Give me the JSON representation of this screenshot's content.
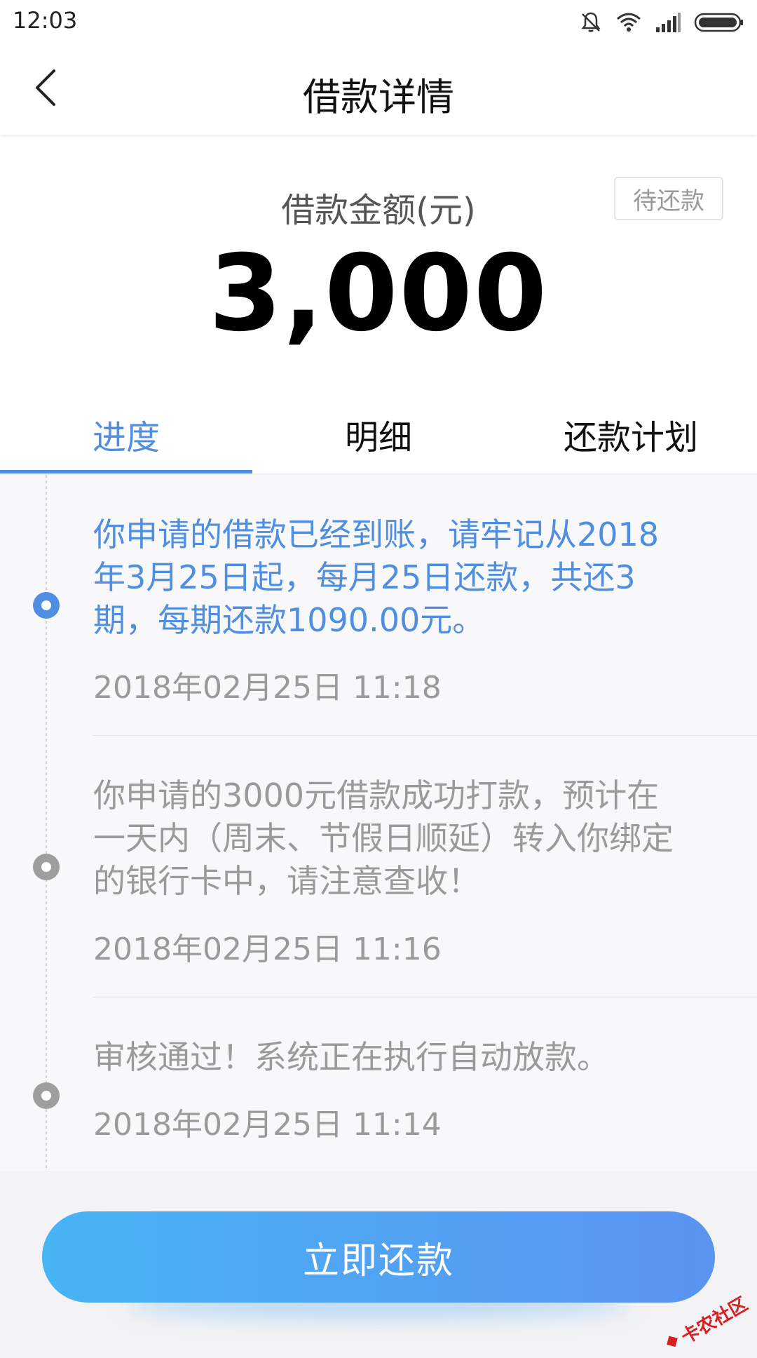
{
  "status_bar": {
    "time": "12:03"
  },
  "header": {
    "title": "借款详情"
  },
  "loan": {
    "amount_label": "借款金额(元)",
    "amount": "3,000",
    "status_badge": "待还款"
  },
  "tabs": [
    {
      "label": "进度",
      "active": true
    },
    {
      "label": "明细",
      "active": false
    },
    {
      "label": "还款计划",
      "active": false
    }
  ],
  "timeline": [
    {
      "lines": [
        "你申请的借款已经到账，请牢记从2018",
        "年3月25日起，每月25日还款，共还3",
        "期，每期还款1090.00元。"
      ],
      "time": "2018年02月25日 11:18",
      "active": true
    },
    {
      "lines": [
        "你申请的3000元借款成功打款，预计在",
        "一天内（周末、节假日顺延）转入你绑定",
        "的银行卡中，请注意查收！"
      ],
      "time": "2018年02月25日 11:16",
      "active": false
    },
    {
      "lines": [
        "审核通过！系统正在执行自动放款。"
      ],
      "time": "2018年02月25日 11:14",
      "active": false
    }
  ],
  "repay_button": {
    "label": "立即还款"
  },
  "watermark": {
    "text": "卡农社区"
  },
  "colors": {
    "accent": "#4f8ee0",
    "button_gradient_start": "#47b4f4",
    "button_gradient_end": "#5b93f1",
    "muted_text": "#9a9a9a"
  },
  "icons": {
    "back": "chevron-left-icon",
    "mute": "bell-off-icon",
    "wifi": "wifi-icon",
    "signal": "signal-icon",
    "battery": "battery-icon"
  }
}
